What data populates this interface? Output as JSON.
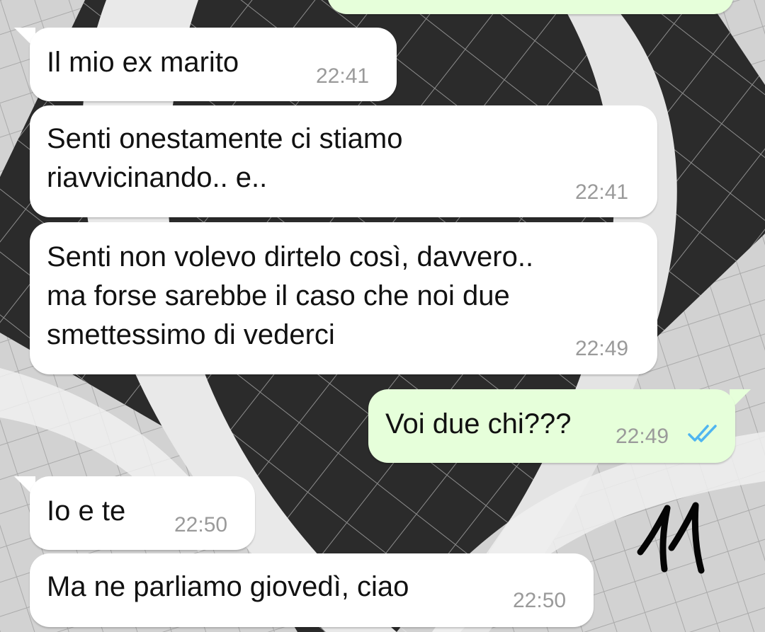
{
  "chat": {
    "messages": [
      {
        "direction": "incoming",
        "text": "Il mio ex marito",
        "time": "22:41"
      },
      {
        "direction": "incoming",
        "text": "Senti onestamente ci stiamo\nriavvicinando.. e..",
        "time": "22:41"
      },
      {
        "direction": "incoming",
        "text": "Senti non volevo dirtelo così, davvero..\nma forse sarebbe il caso che noi due\nsmettessimo di vederci",
        "time": "22:49"
      },
      {
        "direction": "outgoing",
        "text": "Voi due chi???",
        "time": "22:49",
        "status": "read"
      },
      {
        "direction": "incoming",
        "text": "Io e te",
        "time": "22:50"
      },
      {
        "direction": "incoming",
        "text": "Ma ne parliamo giovedì, ciao",
        "time": "22:50"
      }
    ]
  },
  "colors": {
    "incoming_bubble": "#ffffff",
    "outgoing_bubble": "#e6ffda",
    "read_ticks": "#4fb5f0",
    "timestamp": "#9a9a9a"
  },
  "icons": {
    "read_receipt": "double-check-icon"
  },
  "overlay": {
    "handwritten_mark": "11"
  }
}
